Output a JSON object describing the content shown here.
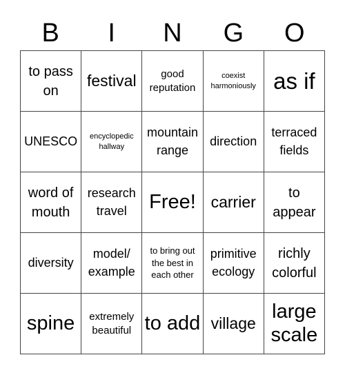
{
  "header": {
    "letters": [
      "B",
      "I",
      "N",
      "G",
      "O"
    ]
  },
  "cells": [
    {
      "text": "to pass on",
      "size": "s-xl"
    },
    {
      "text": "festival",
      "size": "s-xxl"
    },
    {
      "text": "good reputation",
      "size": "s-md"
    },
    {
      "text": "coexist harmoniously",
      "size": "s-xs"
    },
    {
      "text": "as if",
      "size": "s-giant"
    },
    {
      "text": "UNESCO",
      "size": "s-lg"
    },
    {
      "text": "encyclopedic hallway",
      "size": "s-xs"
    },
    {
      "text": "mountain range",
      "size": "s-lg"
    },
    {
      "text": "direction",
      "size": "s-lg"
    },
    {
      "text": "terraced fields",
      "size": "s-lg"
    },
    {
      "text": "word of mouth",
      "size": "s-xl"
    },
    {
      "text": "research travel",
      "size": "s-lg"
    },
    {
      "text": "Free!",
      "size": "s-huge"
    },
    {
      "text": "carrier",
      "size": "s-xxl"
    },
    {
      "text": "to appear",
      "size": "s-xl"
    },
    {
      "text": "diversity",
      "size": "s-lg"
    },
    {
      "text": "model/ example",
      "size": "s-lg"
    },
    {
      "text": "to bring out the best in each other",
      "size": "s-sm"
    },
    {
      "text": "primitive ecology",
      "size": "s-lg"
    },
    {
      "text": "richly colorful",
      "size": "s-xl"
    },
    {
      "text": "spine",
      "size": "s-huge"
    },
    {
      "text": "extremely beautiful",
      "size": "s-md"
    },
    {
      "text": "to add",
      "size": "s-huge"
    },
    {
      "text": "village",
      "size": "s-xxl"
    },
    {
      "text": "large scale",
      "size": "s-huge"
    }
  ]
}
